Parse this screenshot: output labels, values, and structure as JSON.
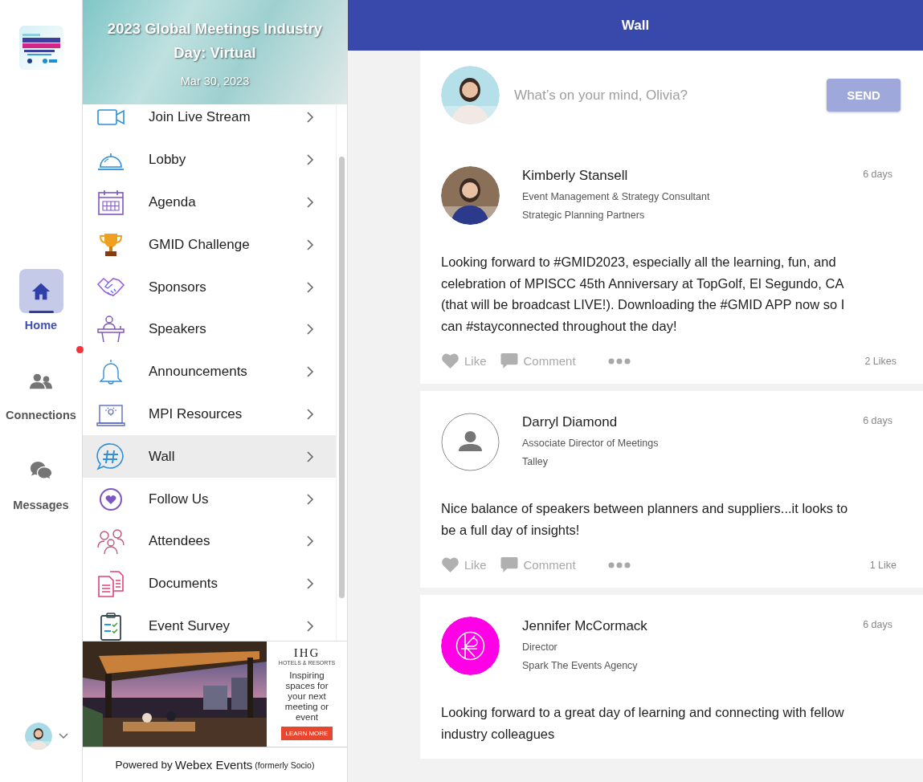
{
  "rail": {
    "items": [
      {
        "label": "Home",
        "kind": "home",
        "selected": true,
        "badge": false
      },
      {
        "label": "Connections",
        "kind": "people",
        "selected": false,
        "badge": true
      },
      {
        "label": "Messages",
        "kind": "chat",
        "selected": false,
        "badge": false
      }
    ]
  },
  "event": {
    "title": "2023 Global Meetings Industry Day: Virtual",
    "date": "Mar 30, 2023"
  },
  "menu": {
    "items": [
      {
        "label": "Join Live Stream",
        "kind": "video",
        "selected": false
      },
      {
        "label": "Lobby",
        "kind": "service-bell",
        "selected": false
      },
      {
        "label": "Agenda",
        "kind": "calendar",
        "selected": false
      },
      {
        "label": "GMID Challenge",
        "kind": "trophy",
        "selected": false
      },
      {
        "label": "Sponsors",
        "kind": "handshake",
        "selected": false
      },
      {
        "label": "Speakers",
        "kind": "podium",
        "selected": false
      },
      {
        "label": "Announcements",
        "kind": "bell",
        "selected": false
      },
      {
        "label": "MPI Resources",
        "kind": "laptop",
        "selected": false
      },
      {
        "label": "Wall",
        "kind": "hashtag-chat",
        "selected": true
      },
      {
        "label": "Follow Us",
        "kind": "heart",
        "selected": false
      },
      {
        "label": "Attendees",
        "kind": "people",
        "selected": false
      },
      {
        "label": "Documents",
        "kind": "documents",
        "selected": false
      },
      {
        "label": "Event Survey",
        "kind": "clipboard",
        "selected": false
      }
    ]
  },
  "ad": {
    "brand": "IHG",
    "brand_sub": "HOTELS & RESORTS",
    "text": "Inspiring spaces for your next meeting or event",
    "button": "LEARN MORE"
  },
  "footer": {
    "prefix": "Powered by",
    "brand": "Webex Events",
    "note": "(formerly Socio)"
  },
  "header": {
    "title": "Wall"
  },
  "composer": {
    "placeholder": "What’s on your mind, Olivia?",
    "button": "SEND"
  },
  "posts": [
    {
      "author": "Kimberly Stansell",
      "title": "Event Management & Strategy Consultant",
      "company": "Strategic Planning Partners",
      "time": "6 days",
      "body": "Looking forward to #GMID2023, especially all the learning, fun, and celebration of MPISCC 45th Anniversary at TopGolf, El Segundo, CA (that will be broadcast LIVE!). Downloading the #GMID APP now so I can #stayconnected throughout the day!",
      "actions": {
        "like": "Like",
        "comment": "Comment"
      },
      "likes": "2 Likes"
    },
    {
      "author": "Darryl Diamond",
      "title": "Associate Director of Meetings",
      "company": "Talley",
      "time": "6 days",
      "avatar": {
        "kind": "default"
      },
      "body": "Nice balance of speakers between planners and suppliers...it looks to be a full day of insights!",
      "actions": {
        "like": "Like",
        "comment": "Comment"
      },
      "likes": "1 Like"
    },
    {
      "author": "Jennifer McCormack",
      "title": "Director",
      "company": "Spark The Events Agency",
      "time": "6 days",
      "avatar": {
        "kind": "logo"
      },
      "body": "Looking forward to a great day of learning and connecting with fellow industry colleagues"
    }
  ]
}
